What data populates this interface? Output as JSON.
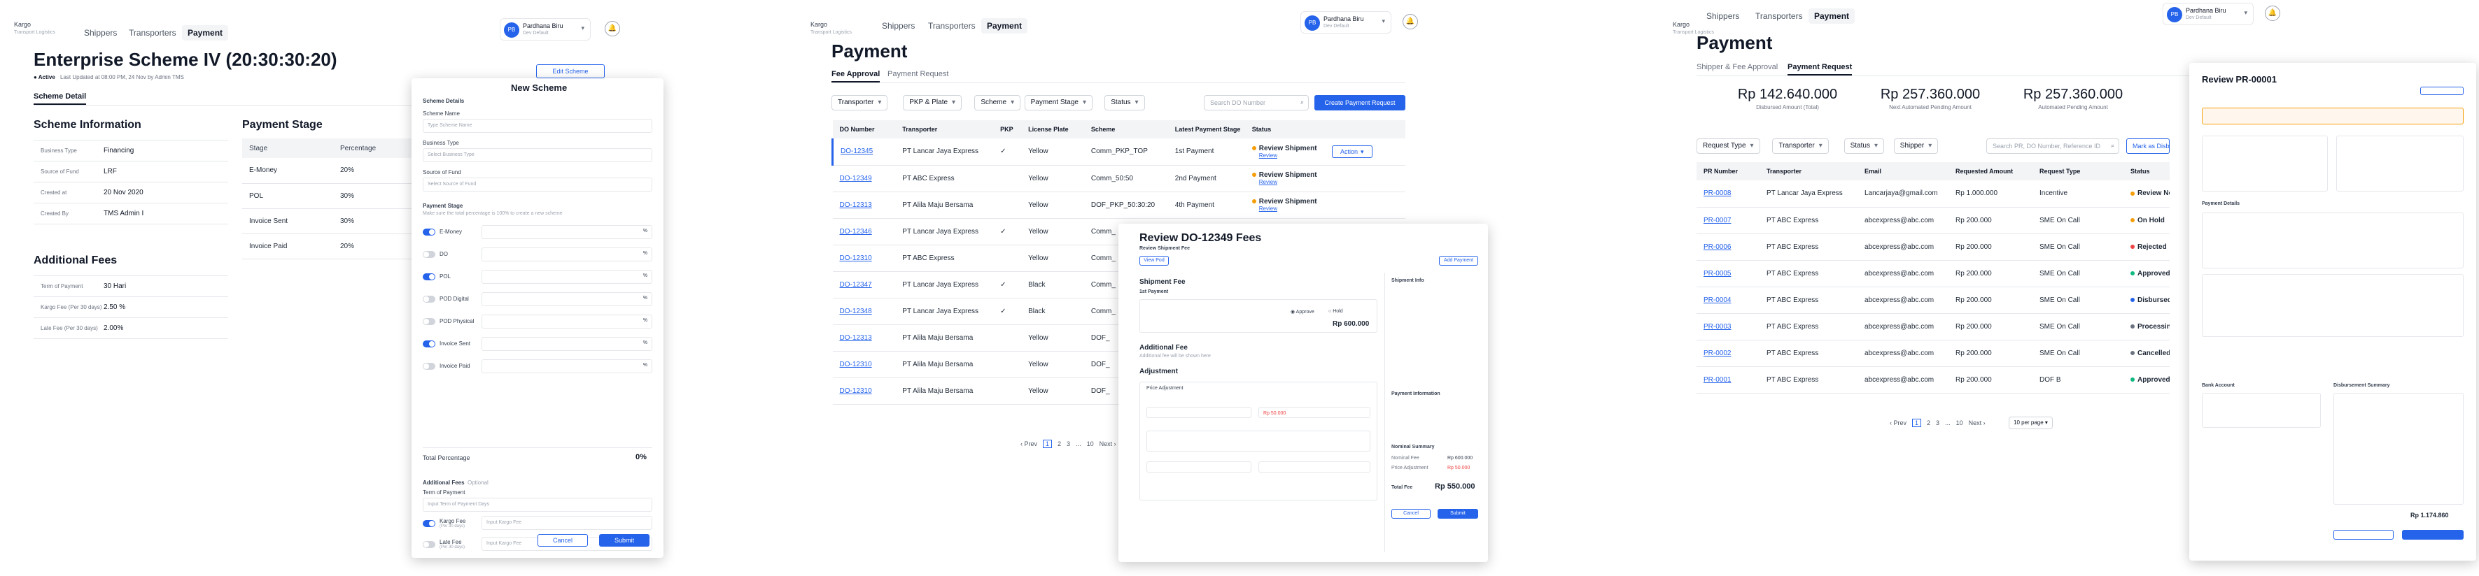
{
  "brand": {
    "name": "Kargo",
    "sub": "Transport Logistics"
  },
  "user": {
    "name": "Pardhana Biru",
    "role": "Dev Default",
    "initials": "PB"
  },
  "nav": {
    "shippers": "Shippers",
    "transporters": "Transporters",
    "payment": "Payment"
  },
  "screen1": {
    "title": "Enterprise Scheme IV (20:30:30:20)",
    "status": "Active",
    "updated": "Last Updated at 08:00 PM, 24 Nov by Admin TMS",
    "edit_button": "Edit Scheme",
    "tab": "Scheme Detail",
    "scheme_info_title": "Scheme Information",
    "scheme_info": [
      {
        "k": "Business Type",
        "v": "Financing"
      },
      {
        "k": "Source of Fund",
        "v": "LRF"
      },
      {
        "k": "Created at",
        "v": "20 Nov 2020"
      },
      {
        "k": "Created By",
        "v": "TMS Admin I"
      }
    ],
    "additional_fees_title": "Additional Fees",
    "additional_fees": [
      {
        "k": "Term of Payment",
        "v": "30 Hari"
      },
      {
        "k": "Kargo Fee (Per 30 days)",
        "v": "2.50 %"
      },
      {
        "k": "Late Fee (Per 30 days)",
        "v": "2.00%"
      }
    ],
    "payment_stage_title": "Payment Stage",
    "stage_headers": [
      "Stage",
      "Percentage"
    ],
    "stages": [
      {
        "stage": "E-Money",
        "pct": "20%"
      },
      {
        "stage": "POL",
        "pct": "30%"
      },
      {
        "stage": "Invoice Sent",
        "pct": "30%"
      },
      {
        "stage": "Invoice Paid",
        "pct": "20%"
      }
    ]
  },
  "new_scheme": {
    "title": "New Scheme",
    "details_label": "Scheme Details",
    "name_label": "Scheme Name",
    "name_ph": "Type Scheme Name",
    "btype_label": "Business Type",
    "btype_ph": "Select Business Type",
    "sof_label": "Source of Fund",
    "sof_ph": "Select Source of Fund",
    "stage_label": "Payment Stage",
    "stage_hint": "Make sure the total percentage is 100% to create a new scheme",
    "stages": [
      {
        "name": "E-Money",
        "on": true
      },
      {
        "name": "DO",
        "on": false
      },
      {
        "name": "POL",
        "on": true
      },
      {
        "name": "POD Digital",
        "on": false
      },
      {
        "name": "POD Physical",
        "on": false
      },
      {
        "name": "Invoice Sent",
        "on": true
      },
      {
        "name": "Invoice Paid",
        "on": false
      }
    ],
    "total_label": "Total Percentage",
    "total_value": "0%",
    "addl_label": "Additional Fees",
    "addl_optional": "Optional",
    "top_label": "Term of Payment",
    "top_ph": "Input Term of Payment Days",
    "kargo_fee": "Kargo Fee",
    "kargo_ph": "Input Kargo Fee",
    "late_fee": "Late Fee",
    "late_ph": "Input Kargo Fee",
    "per30": "(Per 30 days)",
    "cancel": "Cancel",
    "submit": "Submit"
  },
  "screen2": {
    "title": "Payment",
    "tabs": [
      "Fee Approval",
      "Payment Request"
    ],
    "filters": [
      "Transporter",
      "PKP & Plate",
      "Scheme",
      "Payment Stage",
      "Status"
    ],
    "search_ph": "Search DO Number",
    "create_button": "Create Payment Request",
    "headers": [
      "DO Number",
      "Transporter",
      "PKP",
      "License Plate",
      "Scheme",
      "Latest Payment Stage",
      "Status"
    ],
    "rows": [
      {
        "do": "DO-12345",
        "tr": "PT Lancar Jaya Express",
        "pkp": "✓",
        "plate": "Yellow",
        "scheme": "Comm_PKP_TOP",
        "stage": "1st Payment",
        "status": "Review Shipment"
      },
      {
        "do": "DO-12349",
        "tr": "PT ABC Express",
        "pkp": "",
        "plate": "Yellow",
        "scheme": "Comm_50:50",
        "stage": "2nd Payment",
        "status": "Review Shipment"
      },
      {
        "do": "DO-12313",
        "tr": "PT Alila Maju Bersama",
        "pkp": "",
        "plate": "Yellow",
        "scheme": "DOF_PKP_50:30:20",
        "stage": "4th Payment",
        "status": "Review Shipment"
      },
      {
        "do": "DO-12346",
        "tr": "PT Lancar Jaya Express",
        "pkp": "✓",
        "plate": "Yellow",
        "scheme": "Comm_",
        "stage": "",
        "status": ""
      },
      {
        "do": "DO-12310",
        "tr": "PT ABC Express",
        "pkp": "",
        "plate": "Yellow",
        "scheme": "Comm_",
        "stage": "",
        "status": ""
      },
      {
        "do": "DO-12347",
        "tr": "PT Lancar Jaya Express",
        "pkp": "✓",
        "plate": "Black",
        "scheme": "Comm_",
        "stage": "",
        "status": ""
      },
      {
        "do": "DO-12348",
        "tr": "PT Lancar Jaya Express",
        "pkp": "✓",
        "plate": "Black",
        "scheme": "Comm_",
        "stage": "",
        "status": ""
      },
      {
        "do": "DO-12313",
        "tr": "PT Alila Maju Bersama",
        "pkp": "",
        "plate": "Yellow",
        "scheme": "DOF_",
        "stage": "",
        "status": ""
      },
      {
        "do": "DO-12310",
        "tr": "PT Alila Maju Bersama",
        "pkp": "",
        "plate": "Yellow",
        "scheme": "DOF_",
        "stage": "",
        "status": ""
      },
      {
        "do": "DO-12310",
        "tr": "PT Alila Maju Bersama",
        "pkp": "",
        "plate": "Yellow",
        "scheme": "DOF_",
        "stage": "",
        "status": ""
      }
    ],
    "review_link": "Review",
    "action": "Action",
    "pager": [
      "‹ Prev",
      "1",
      "2",
      "3",
      "...",
      "10",
      "Next ›"
    ]
  },
  "review_do": {
    "title": "Review DO-12349 Fees",
    "sub": "Review Shipment Fee",
    "view_pod": "View Pod",
    "shipment_fee": "Shipment Fee",
    "first_payment": "1st Payment",
    "approve": "Approve",
    "hold": "Hold",
    "shipment_fee_value": "Rp 600.000",
    "additional_fee": "Additional Fee",
    "additional_hint": "Additional fee will be shown here",
    "adjustment": "Adjustment",
    "price_adjustment": "Price Adjustment",
    "adj_amount": "Rp 50.000",
    "add_payment": "Add Payment",
    "shipment_info": "Shipment Info",
    "payment_info": "Payment Information",
    "nominal_summary": "Nominal Summary",
    "summary": [
      {
        "k": "Nominal Fee",
        "v": "Rp 600.000"
      },
      {
        "k": "Price Adjustment",
        "v": "Rp 50.000"
      }
    ],
    "total_label": "Total Fee",
    "total_value": "Rp 550.000",
    "cancel": "Cancel",
    "submit": "Submit"
  },
  "screen3": {
    "title": "Payment",
    "tabs": [
      "Shipper & Fee Approval",
      "Payment Request"
    ],
    "stats": [
      {
        "amount": "Rp 142.640.000",
        "label": "Disbursed Amount (Total)"
      },
      {
        "amount": "Rp 257.360.000",
        "label": "Next Automated Pending Amount"
      },
      {
        "amount": "Rp 257.360.000",
        "label": "Automated Pending Amount"
      }
    ],
    "filters": [
      "Request Type",
      "Transporter",
      "Status",
      "Shipper"
    ],
    "search_ph": "Search PR, DO Number, Reference ID",
    "mark_button": "Mark as Disbursed",
    "headers": [
      "PR Number",
      "Transporter",
      "Email",
      "Requested Amount",
      "Request Type",
      "Status"
    ],
    "rows": [
      {
        "pr": "PR-0008",
        "tr": "PT Lancar Jaya Express",
        "email": "Lancarjaya@gmail.com",
        "amt": "Rp 1.000.000",
        "type": "Incentive",
        "status": "Review Now",
        "color": "#f59e0b"
      },
      {
        "pr": "PR-0007",
        "tr": "PT ABC Express",
        "email": "abcexpress@abc.com",
        "amt": "Rp 200.000",
        "type": "SME On Call",
        "status": "On Hold",
        "color": "#f59e0b"
      },
      {
        "pr": "PR-0006",
        "tr": "PT ABC Express",
        "email": "abcexpress@abc.com",
        "amt": "Rp 200.000",
        "type": "SME On Call",
        "status": "Rejected",
        "color": "#ef4444"
      },
      {
        "pr": "PR-0005",
        "tr": "PT ABC Express",
        "email": "abcexpress@abc.com",
        "amt": "Rp 200.000",
        "type": "SME On Call",
        "status": "Approved",
        "color": "#10b981"
      },
      {
        "pr": "PR-0004",
        "tr": "PT ABC Express",
        "email": "abcexpress@abc.com",
        "amt": "Rp 200.000",
        "type": "SME On Call",
        "status": "Disbursed",
        "color": "#2563eb"
      },
      {
        "pr": "PR-0003",
        "tr": "PT ABC Express",
        "email": "abcexpress@abc.com",
        "amt": "Rp 200.000",
        "type": "SME On Call",
        "status": "Processing",
        "color": "#6b7280"
      },
      {
        "pr": "PR-0002",
        "tr": "PT ABC Express",
        "email": "abcexpress@abc.com",
        "amt": "Rp 200.000",
        "type": "SME On Call",
        "status": "Cancelled",
        "color": "#6b7280"
      },
      {
        "pr": "PR-0001",
        "tr": "PT ABC Express",
        "email": "abcexpress@abc.com",
        "amt": "Rp 200.000",
        "type": "DOF B",
        "status": "Approved",
        "color": "#10b981"
      }
    ],
    "pager": [
      "‹ Prev",
      "1",
      "2",
      "3",
      "...",
      "10",
      "Next ›"
    ],
    "per_page": "10 per page"
  },
  "review_pr": {
    "title": "Review PR-00001",
    "payment_details": "Payment Details",
    "bank_account": "Bank Account",
    "disbursement_summary": "Disbursement Summary",
    "total_value": "Rp 1.174.860"
  }
}
